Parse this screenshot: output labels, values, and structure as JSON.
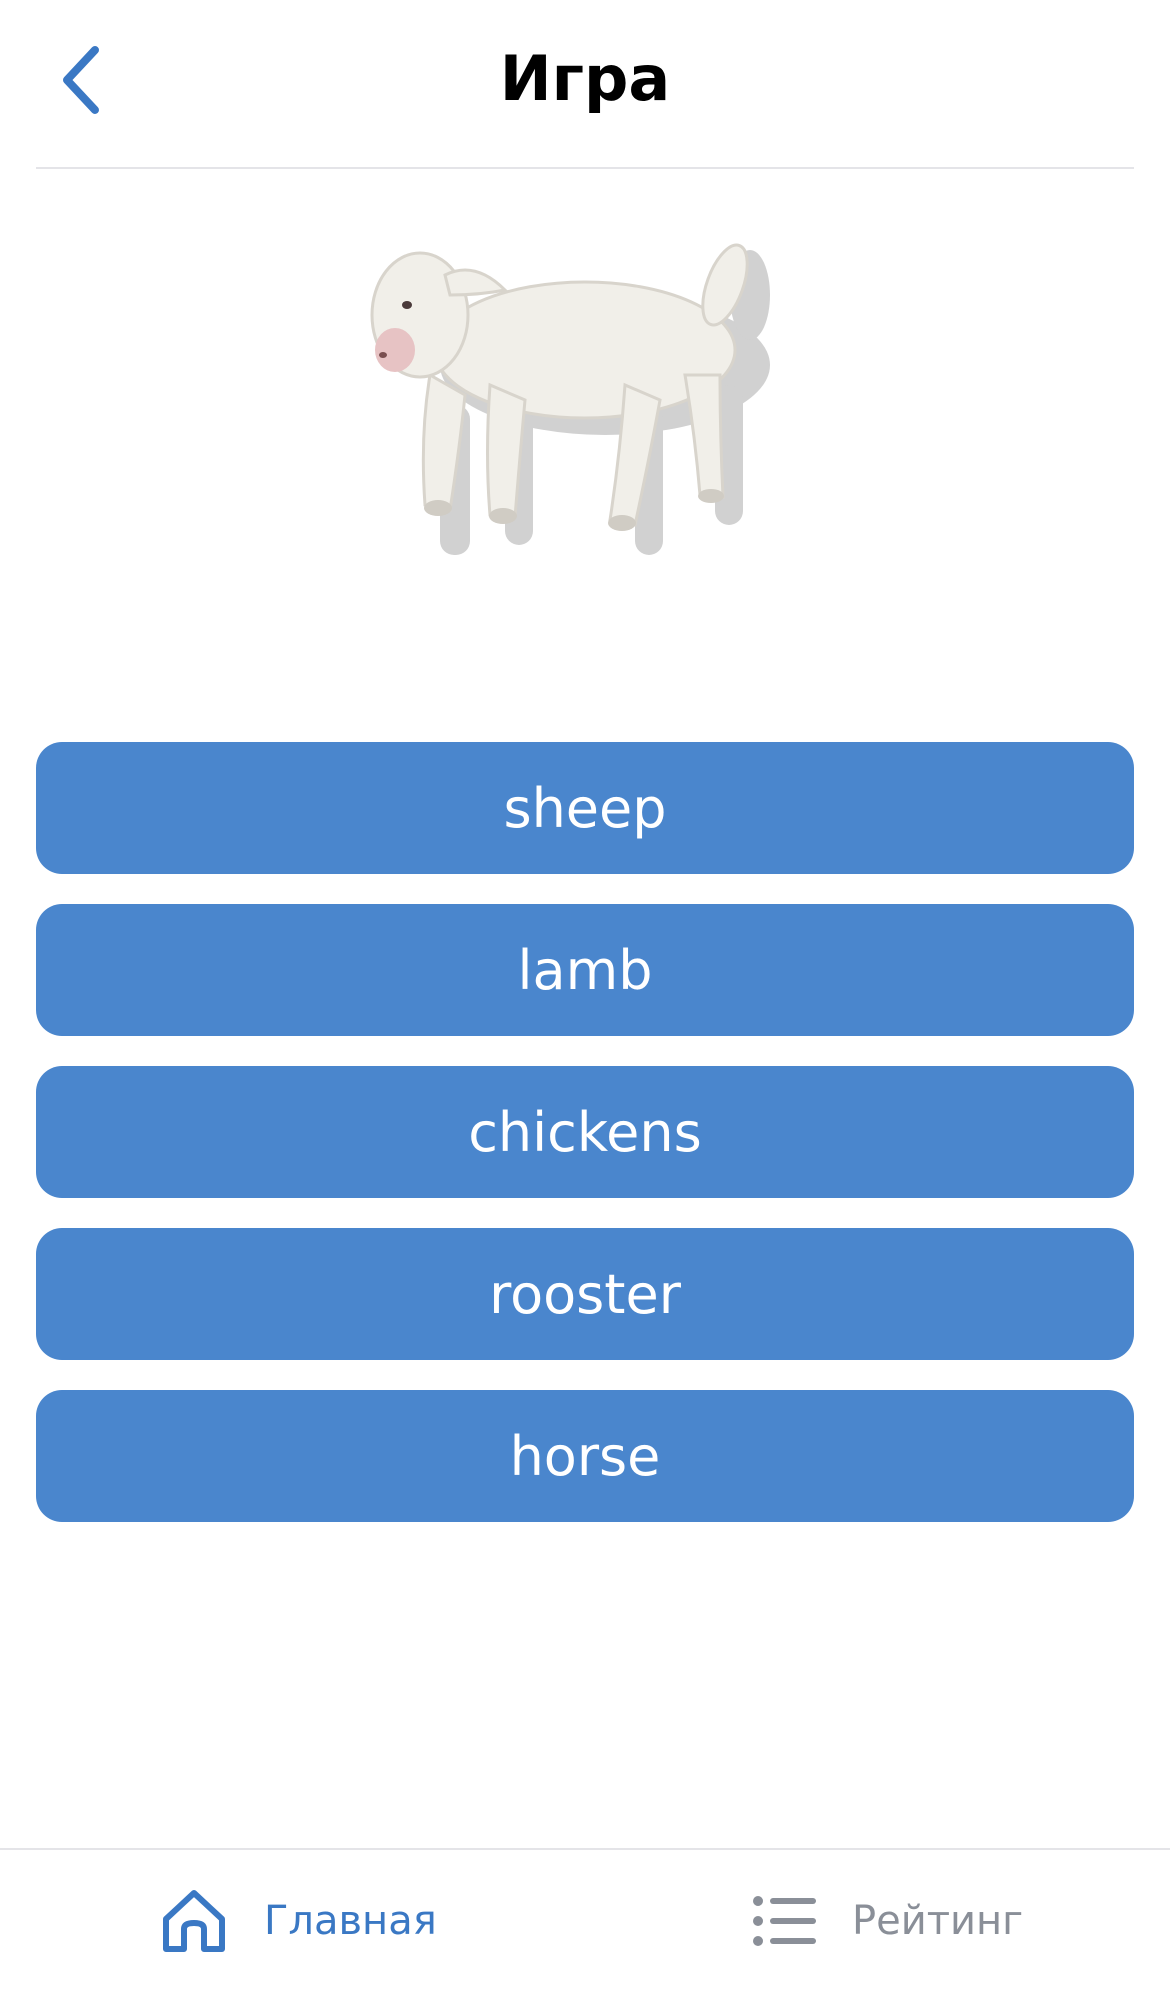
{
  "header": {
    "title": "Игра",
    "back_icon": "chevron-left-icon"
  },
  "picture": {
    "subject": "lamb"
  },
  "answers": [
    {
      "label": "sheep"
    },
    {
      "label": "lamb"
    },
    {
      "label": "chickens"
    },
    {
      "label": "rooster"
    },
    {
      "label": "horse"
    }
  ],
  "tabbar": {
    "home": {
      "label": "Главная",
      "icon": "home-icon",
      "active": true
    },
    "rating": {
      "label": "Рейтинг",
      "icon": "list-icon",
      "active": false
    }
  },
  "colors": {
    "accent": "#4a86cd",
    "active_tab": "#3a78c4",
    "inactive_tab": "#8a8f98"
  }
}
